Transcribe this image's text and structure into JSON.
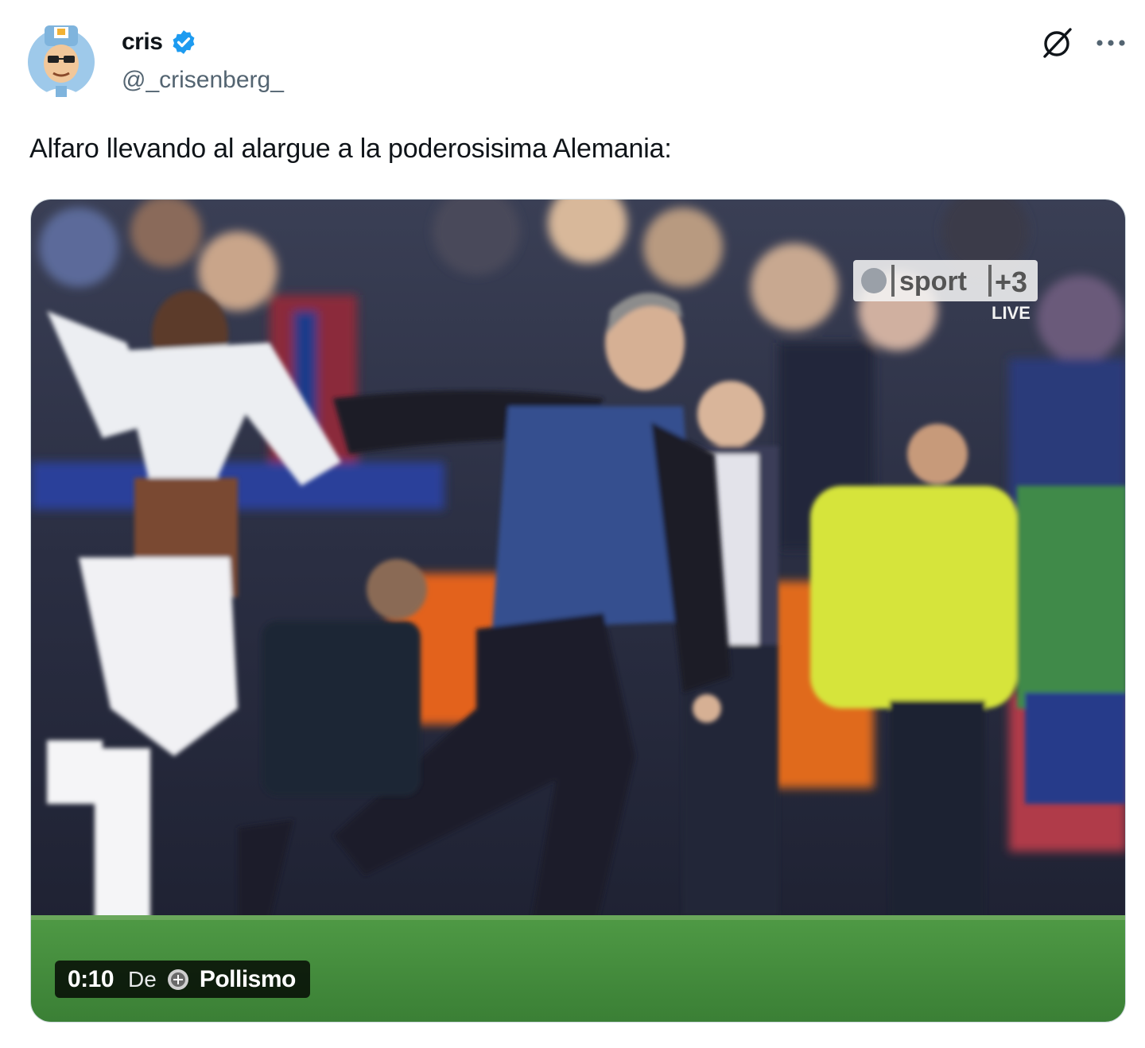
{
  "author": {
    "display_name": "cris",
    "handle": "@_crisenberg_",
    "verified_icon": "verified-badge-icon",
    "avatar_icon": "cartoon-avatar-icon"
  },
  "actions": {
    "grok_icon": "grok-icon",
    "more_icon": "more-options-icon"
  },
  "tweet": {
    "text": "Alfaro llevando al alargue a la poderosisima Alemania:"
  },
  "video": {
    "timestamp": "0:10",
    "from_label": "De",
    "source_name": "Pollismo",
    "watermark_channel": "sport",
    "watermark_number": "+3",
    "watermark_live": "LIVE"
  },
  "colors": {
    "verified_blue": "#1d9bf0",
    "text_primary": "#0f1419",
    "text_secondary": "#536471",
    "pitch_green": "#3d8a3a"
  }
}
